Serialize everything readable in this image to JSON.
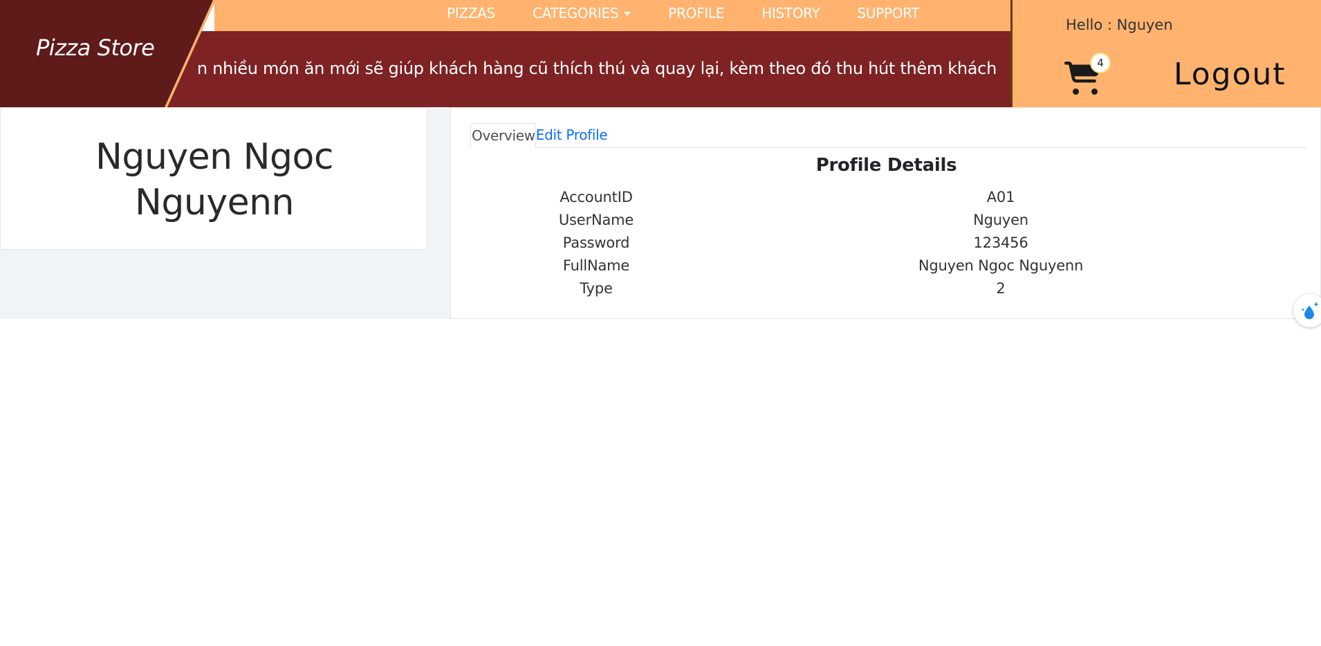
{
  "brand": {
    "name": "Pizza Store"
  },
  "nav": {
    "items": [
      {
        "label": "PIZZAS"
      },
      {
        "label": "CATEGORIES"
      },
      {
        "label": "PROFILE"
      },
      {
        "label": "HISTORY"
      },
      {
        "label": "SUPPORT"
      }
    ]
  },
  "marquee": {
    "text": "n nhiều món ăn mới sẽ giúp khách hàng cũ thích thú và quay lại, kèm theo đó thu hút thêm khách"
  },
  "user": {
    "greeting": "Hello : Nguyen",
    "cart_count": "4",
    "logout_label": "Logout"
  },
  "profile_card": {
    "name_line1": "Nguyen Ngoc",
    "name_line2": "Nguyenn"
  },
  "tabs": [
    {
      "label": "Overview",
      "active": true
    },
    {
      "label": "Edit Profile",
      "active": false
    }
  ],
  "details": {
    "title": "Profile Details",
    "rows": [
      {
        "label": "AccountID",
        "value": "A01"
      },
      {
        "label": "UserName",
        "value": "Nguyen"
      },
      {
        "label": "Password",
        "value": "123456"
      },
      {
        "label": "FullName",
        "value": "Nguyen Ngoc Nguyenn"
      },
      {
        "label": "Type",
        "value": "2"
      }
    ]
  },
  "colors": {
    "nav_bg": "#ffb36f",
    "brand_bg": "#5f1a1a",
    "marquee_bg": "#7e2224",
    "link": "#0d6efd"
  },
  "icons": {
    "cart": "cart-icon",
    "floating": "sparkle-drop-icon"
  }
}
